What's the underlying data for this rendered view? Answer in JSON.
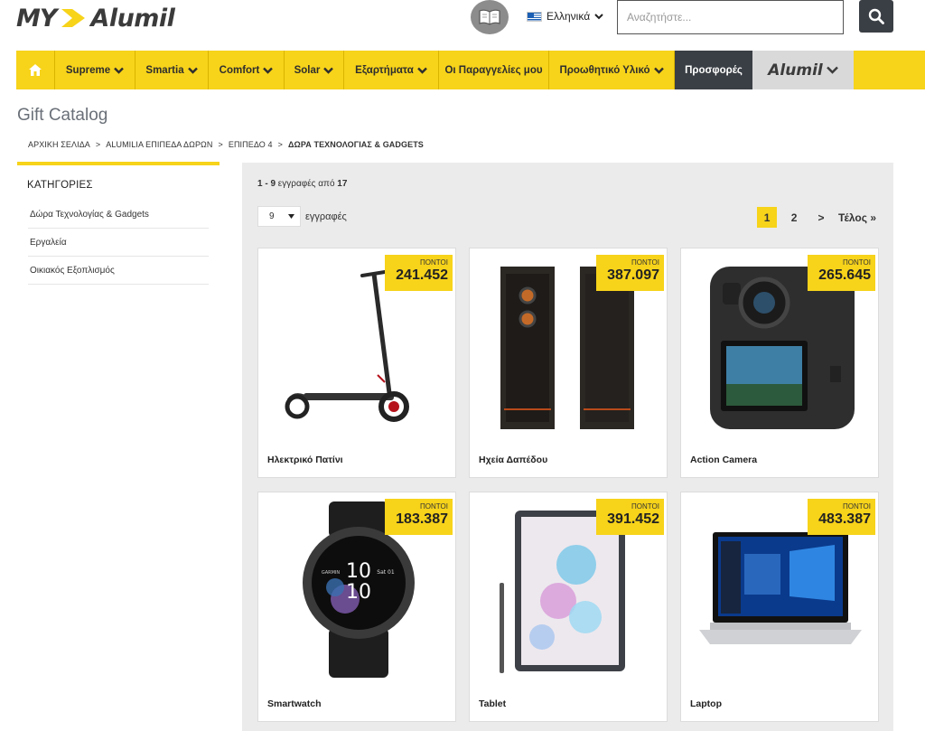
{
  "header": {
    "logo_my": "MY",
    "logo_alumil": "Alumil",
    "language": "Ελληνικά",
    "search_placeholder": "Αναζητήστε..."
  },
  "nav": {
    "items": [
      {
        "label": "Supreme"
      },
      {
        "label": "Smartia"
      },
      {
        "label": "Comfort"
      },
      {
        "label": "Solar"
      },
      {
        "label": "Εξαρτήματα"
      },
      {
        "label": "Οι Παραγγελίες μου"
      },
      {
        "label": "Προωθητικό Υλικό"
      },
      {
        "label": "Προσφορές"
      }
    ],
    "brand_label": "Alumil"
  },
  "page": {
    "title": "Gift Catalog",
    "breadcrumb": [
      "ΑΡΧΙΚΗ ΣΕΛΙΔΑ",
      "ALUMILIA ΕΠΙΠΕΔΑ ΔΩΡΩΝ",
      "ΕΠΙΠΕΔΟ 4",
      "ΔΩΡΑ ΤΕΧΝΟΛΟΓΙΑΣ & GADGETS"
    ],
    "breadcrumb_sep": ">"
  },
  "sidebar": {
    "title": "ΚΑΤΗΓΟΡΙΕΣ",
    "items": [
      {
        "label": "Δώρα Τεχνολογίας & Gadgets"
      },
      {
        "label": "Εργαλεία"
      },
      {
        "label": "Οικιακός Εξοπλισμός"
      }
    ]
  },
  "listing": {
    "count_range": "1 - 9",
    "count_mid": " εγγραφές από ",
    "count_total": "17",
    "per_page_value": "9",
    "per_page_label": "εγγραφές",
    "pages": [
      "1",
      "2"
    ],
    "next": ">",
    "last": "Τέλος »"
  },
  "products": [
    {
      "name": "Ηλεκτρικό Πατίνι",
      "points_label": "ΠΟΝΤΟΙ",
      "points": "241.452"
    },
    {
      "name": "Ηχεία Δαπέδου",
      "points_label": "ΠΟΝΤΟΙ",
      "points": "387.097"
    },
    {
      "name": "Action Camera",
      "points_label": "ΠΟΝΤΟΙ",
      "points": "265.645"
    },
    {
      "name": "Smartwatch",
      "points_label": "ΠΟΝΤΟΙ",
      "points": "183.387"
    },
    {
      "name": "Tablet",
      "points_label": "ΠΟΝΤΟΙ",
      "points": "391.452"
    },
    {
      "name": "Laptop",
      "points_label": "ΠΟΝΤΟΙ",
      "points": "483.387"
    }
  ],
  "watch": {
    "time_h": "10",
    "time_m": "10",
    "date": "Sat 01",
    "brand": "GARMIN"
  },
  "colors": {
    "accent": "#f7d31a",
    "dark": "#3a3f45",
    "panel": "#ebebeb"
  }
}
